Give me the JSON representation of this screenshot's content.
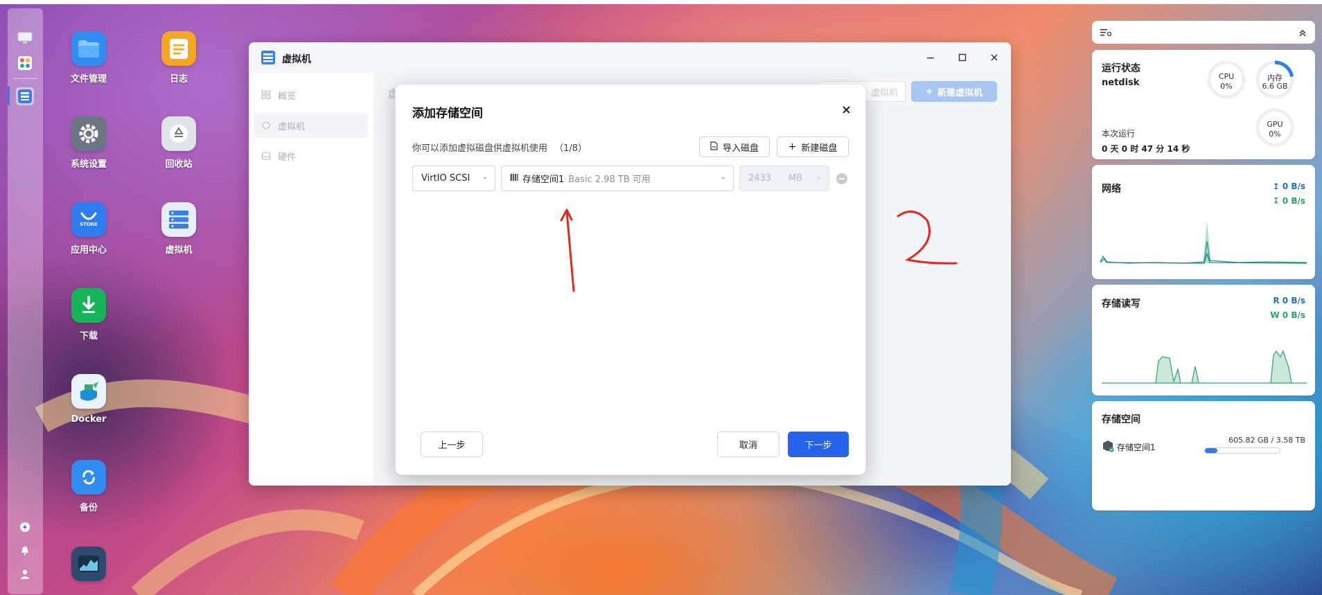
{
  "dock": {
    "items": [
      {
        "icon": "monitor-icon"
      },
      {
        "icon": "app-grid-icon"
      },
      {
        "icon": "vm-server-icon",
        "active": true
      }
    ],
    "bottom": [
      {
        "icon": "lightning-icon"
      },
      {
        "icon": "bell-icon"
      },
      {
        "icon": "user-icon"
      }
    ]
  },
  "desktop": {
    "icons": [
      {
        "label": "文件管理",
        "icon": "folder-icon",
        "color": "#2f8cf0"
      },
      {
        "label": "日志",
        "icon": "log-icon",
        "color": "#f7a623"
      },
      {
        "label": "系统设置",
        "icon": "settings-icon",
        "color": "#6b7584"
      },
      {
        "label": "回收站",
        "icon": "recycle-icon",
        "color": "#dfe3ea"
      },
      {
        "label": "应用中心",
        "icon": "store-icon",
        "color": "#2f7cf0",
        "badge": "STORE"
      },
      {
        "label": "虚拟机",
        "icon": "vm-icon",
        "color": "#e8eef8"
      },
      {
        "label": "下载",
        "icon": "download-icon",
        "color": "#17b45a"
      },
      {
        "label": "Docker",
        "icon": "docker-icon",
        "color": "#e9f3fb"
      },
      {
        "label": "备份",
        "icon": "backup-icon",
        "color": "#2f8cf0"
      },
      {
        "label": "",
        "icon": "monitor-app-icon",
        "color": "#2d4a6e"
      }
    ]
  },
  "window": {
    "title": "虚拟机",
    "sidebar": [
      {
        "label": "概览",
        "icon": "overview-icon"
      },
      {
        "label": "虚拟机",
        "icon": "cube-icon",
        "active": true
      },
      {
        "label": "硬件",
        "icon": "hardware-icon"
      }
    ],
    "header_partial": "虚",
    "header_buttons": {
      "secondary": "虚拟机",
      "primary": "新建虚拟机"
    }
  },
  "dialog": {
    "title": "添加存储空间",
    "description": "你可以添加虚拟磁盘供虚拟机使用",
    "count": "（1/8）",
    "import_label": "导入磁盘",
    "new_label": "新建磁盘",
    "bus": "VirtIO SCSI",
    "storage_name": "存储空间1",
    "storage_detail": "Basic  2.98 TB 可用",
    "size_value": "2433",
    "size_unit": "MB",
    "prev_label": "上一步",
    "cancel_label": "取消",
    "next_label": "下一步"
  },
  "annotation": {
    "arrow_color": "#e02a1e",
    "mark_label": "2"
  },
  "widgets": {
    "status": {
      "title": "运行状态",
      "host": "netdisk",
      "cpu_label": "CPU",
      "cpu_value": "0%",
      "cpu_fraction": 0,
      "mem_label": "内存",
      "mem_value": "6.6 GB",
      "mem_fraction": 0.22,
      "gpu_label": "GPU",
      "gpu_value": "0%",
      "gpu_fraction": 0,
      "uptime_label": "本次运行",
      "uptime_value": "0 天 0 时 47 分 14 秒"
    },
    "network": {
      "title": "网络",
      "up": "0 B/s",
      "down": "0 B/s"
    },
    "disk_io": {
      "title": "存储读写",
      "read_prefix": "R",
      "read": "0 B/s",
      "write_prefix": "W",
      "write": "0 B/s"
    },
    "storage": {
      "title": "存储空间",
      "pool": "存储空间1",
      "usage": "605.82 GB / 3.58 TB",
      "used_fraction": 0.17
    }
  }
}
